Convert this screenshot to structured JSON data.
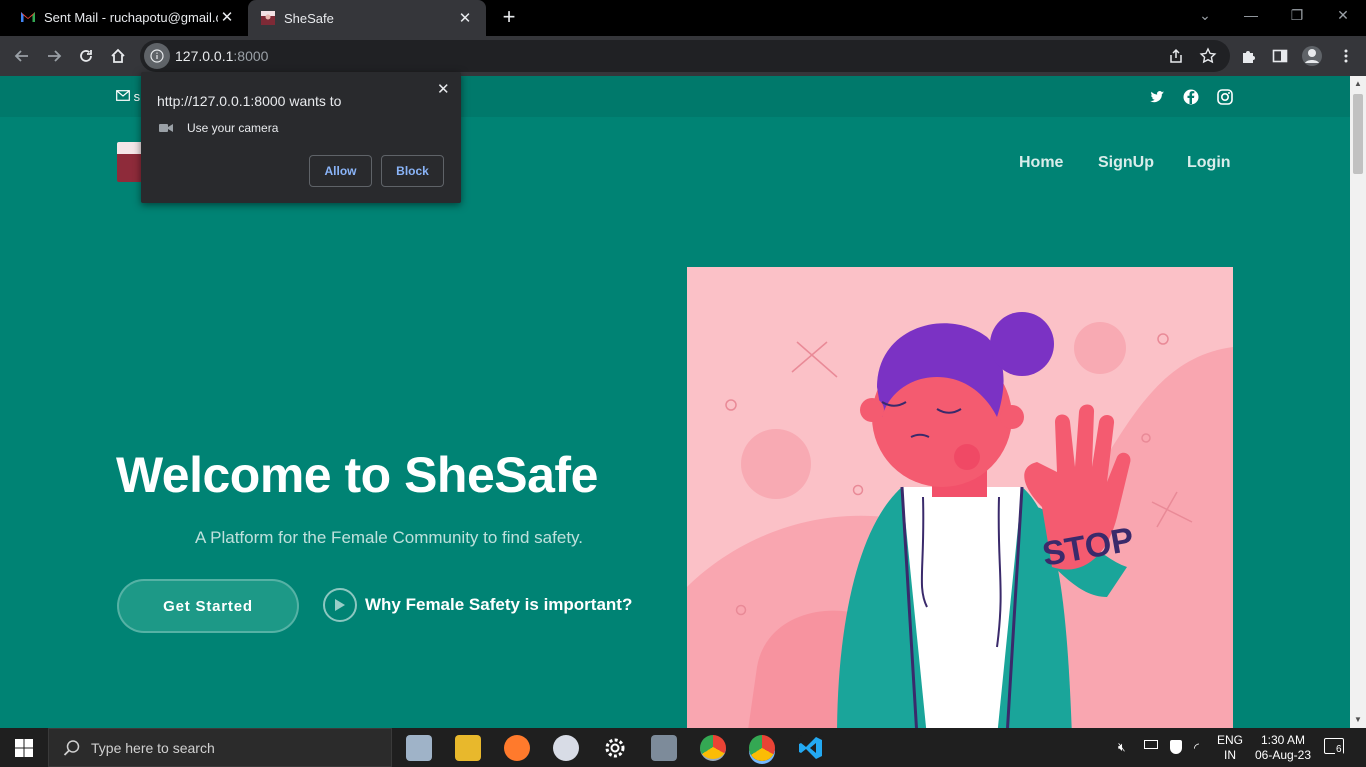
{
  "browser": {
    "tabs": [
      {
        "title": "Sent Mail - ruchapotu@gmail.co",
        "active": false,
        "icon": "gmail-icon"
      },
      {
        "title": "SheSafe",
        "active": true,
        "icon": "shesafe-favicon"
      }
    ],
    "new_tab": "+",
    "url_host": "127.0.0.1",
    "url_port": ":8000"
  },
  "permission_popup": {
    "title": "http://127.0.0.1:8000 wants to",
    "request": "Use your camera",
    "allow": "Allow",
    "block": "Block",
    "close": "✕"
  },
  "site": {
    "topbar_email_fragment": "s",
    "nav": [
      {
        "label": "Home"
      },
      {
        "label": "SignUp"
      },
      {
        "label": "Login"
      }
    ],
    "hero": {
      "title": "Welcome to SheSafe",
      "subtitle": "A Platform for the Female Community to find safety.",
      "cta": "Get Started",
      "video_link": "Why Female Safety is important?"
    },
    "illustration_sign_text": "STOP",
    "colors": {
      "primary": "#008374",
      "accent": "#1d9987",
      "illustration_bg": "#fbc1c7"
    }
  },
  "taskbar": {
    "search_placeholder": "Type here to search",
    "lang_top": "ENG",
    "lang_bottom": "IN",
    "time": "1:30 AM",
    "date": "06-Aug-23",
    "notification_count": "6"
  }
}
